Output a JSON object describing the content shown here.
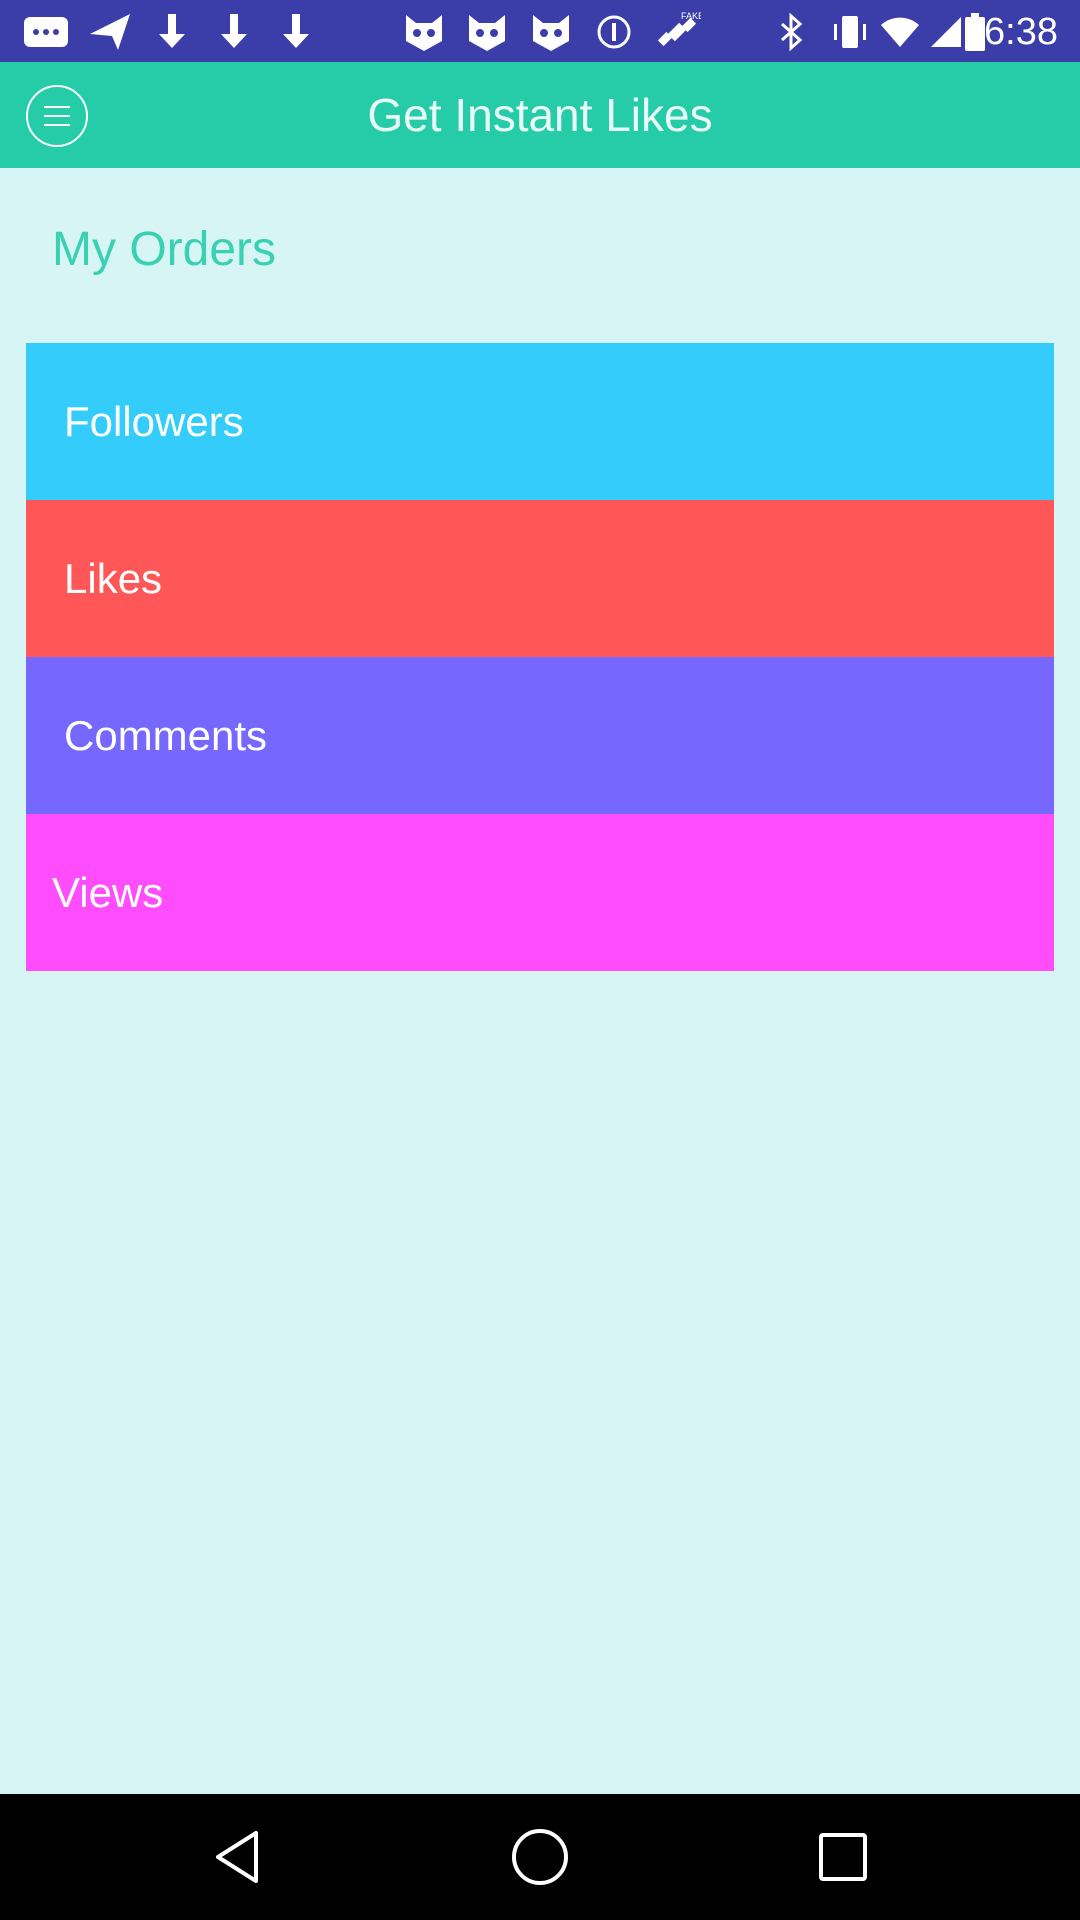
{
  "status_bar": {
    "time": "6:38",
    "icons": [
      "messages-icon",
      "navigation-arrow-icon",
      "download-icon-1",
      "download-icon-2",
      "download-icon-3",
      "cat-face-icon-1",
      "cat-face-icon-2",
      "cat-face-icon-3",
      "circle-info-icon",
      "fake-gps-satellite-icon",
      "bluetooth-icon",
      "vibrate-icon",
      "wifi-icon",
      "signal-icon",
      "battery-icon"
    ],
    "fake_label": "FAKE"
  },
  "app_bar": {
    "title": "Get Instant Likes",
    "menu_icon": "hamburger-menu-icon"
  },
  "section": {
    "title": "My Orders"
  },
  "orders": [
    {
      "label": "Followers",
      "color": "#34cdfb"
    },
    {
      "label": "Likes",
      "color": "#ff5757"
    },
    {
      "label": "Comments",
      "color": "#7667ff"
    },
    {
      "label": "Views",
      "color": "#ff4cfc"
    }
  ],
  "nav_bar": {
    "icons": [
      "back-triangle-icon",
      "home-circle-icon",
      "recents-square-icon"
    ]
  },
  "colors": {
    "status_bar": "#3b3ea8",
    "app_bar": "#26cba7",
    "background": "#d7f5f5",
    "section_title": "#3ad1b3"
  }
}
